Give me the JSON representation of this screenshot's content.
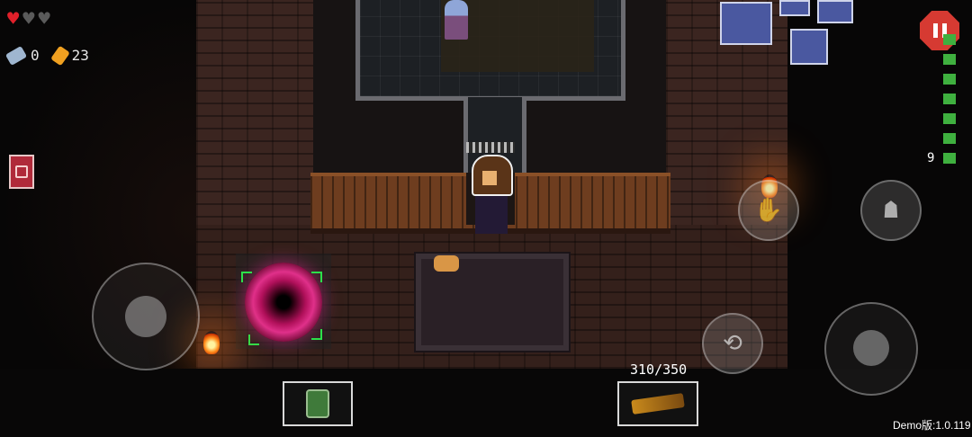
{
  "hud": {
    "hearts": [
      "full",
      "empty",
      "empty"
    ],
    "blanks_count": "0",
    "shells_count": "23",
    "floor_number": "9",
    "ammo_readout": "310/350",
    "version_text": "Demo版:1.0.119",
    "heart_full_glyph": "♥",
    "heart_empty_glyph": "♥"
  },
  "icons": {
    "blank": "blank-icon",
    "shell": "shell-currency-icon",
    "item_book": "book-item-icon",
    "pause": "pause-icon",
    "dodge_roll": "dodge-roll-icon",
    "interact": "interact-hand-icon",
    "reload": "reload-icon",
    "active_item": "jar-item-icon",
    "weapon": "gun-icon"
  },
  "colors": {
    "heart_full": "#e0202a",
    "heart_empty": "#5a5a5a",
    "pause_button": "#d63a32",
    "floor_track": "#3fb03f"
  }
}
